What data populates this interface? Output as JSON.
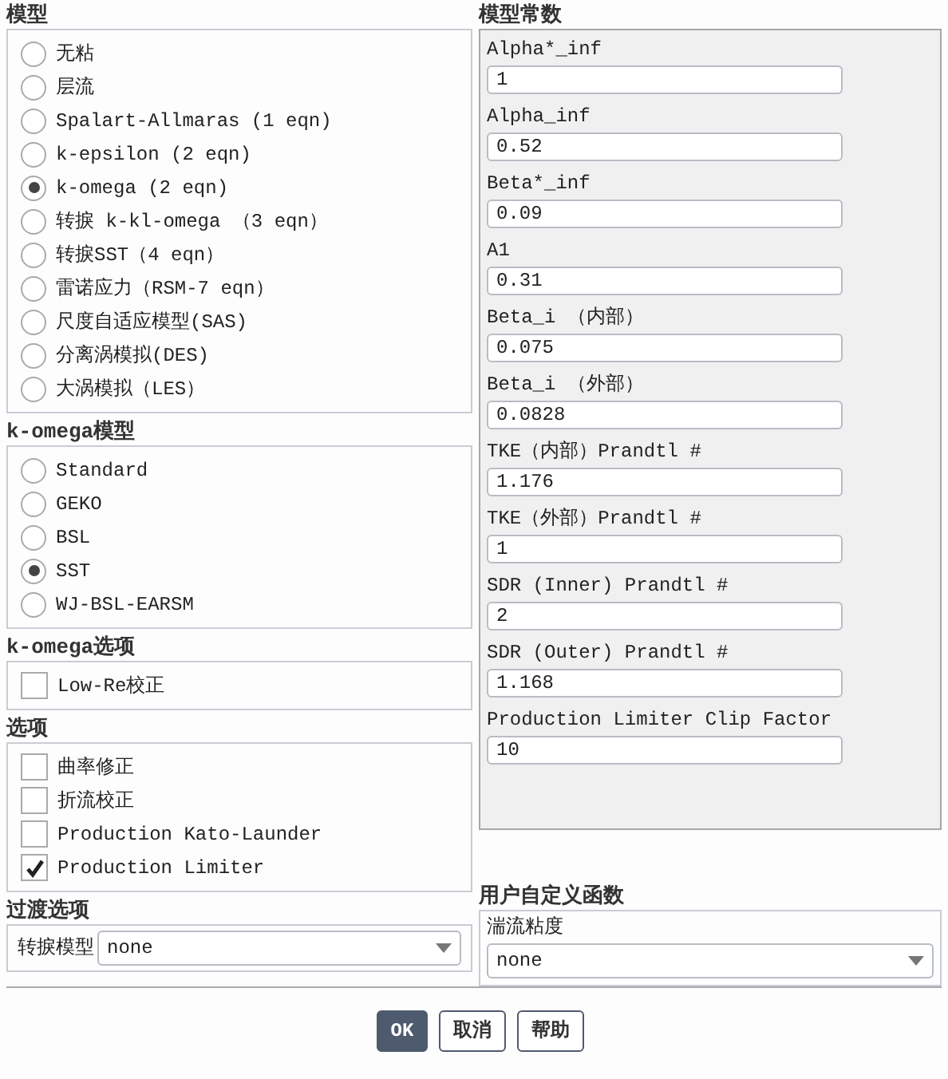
{
  "models": {
    "title": "模型",
    "options": [
      {
        "label": "无粘",
        "selected": false
      },
      {
        "label": "层流",
        "selected": false
      },
      {
        "label": "Spalart-Allmaras (1 eqn)",
        "selected": false
      },
      {
        "label": "k-epsilon (2 eqn)",
        "selected": false
      },
      {
        "label": "k-omega (2 eqn)",
        "selected": true
      },
      {
        "label": "转捩 k-kl-omega （3 eqn）",
        "selected": false
      },
      {
        "label": "转捩SST（4 eqn）",
        "selected": false
      },
      {
        "label": "雷诺应力（RSM-7 eqn）",
        "selected": false
      },
      {
        "label": "尺度自适应模型(SAS)",
        "selected": false
      },
      {
        "label": "分离涡模拟(DES)",
        "selected": false
      },
      {
        "label": "大涡模拟（LES）",
        "selected": false
      }
    ]
  },
  "komega_model": {
    "title": "k-omega模型",
    "options": [
      {
        "label": "Standard",
        "selected": false
      },
      {
        "label": "GEKO",
        "selected": false
      },
      {
        "label": "BSL",
        "selected": false
      },
      {
        "label": "SST",
        "selected": true
      },
      {
        "label": "WJ-BSL-EARSM",
        "selected": false
      }
    ]
  },
  "komega_options": {
    "title": "k-omega选项",
    "checkboxes": [
      {
        "label": "Low-Re校正",
        "checked": false
      }
    ]
  },
  "options": {
    "title": "选项",
    "checkboxes": [
      {
        "label": "曲率修正",
        "checked": false
      },
      {
        "label": "折流校正",
        "checked": false
      },
      {
        "label": "Production Kato-Launder",
        "checked": false
      },
      {
        "label": "Production Limiter",
        "checked": true
      }
    ]
  },
  "transition_options": {
    "title": "过渡选项",
    "field_label": "转捩模型",
    "dropdown": {
      "value": "none"
    }
  },
  "model_constants": {
    "title": "模型常数",
    "fields": [
      {
        "label": "Alpha*_inf",
        "value": "1"
      },
      {
        "label": "Alpha_inf",
        "value": "0.52"
      },
      {
        "label": "Beta*_inf",
        "value": "0.09"
      },
      {
        "label": "A1",
        "value": "0.31"
      },
      {
        "label": "Beta_i （内部）",
        "value": "0.075"
      },
      {
        "label": "Beta_i （外部）",
        "value": "0.0828"
      },
      {
        "label": "TKE（内部）Prandtl #",
        "value": "1.176"
      },
      {
        "label": "TKE（外部）Prandtl #",
        "value": "1"
      },
      {
        "label": "SDR (Inner) Prandtl #",
        "value": "2"
      },
      {
        "label": "SDR (Outer) Prandtl #",
        "value": "1.168"
      },
      {
        "label": "Production Limiter Clip Factor",
        "value": "10"
      }
    ]
  },
  "udf": {
    "title": "用户自定义函数",
    "field_label": "湍流粘度",
    "dropdown": {
      "value": "none"
    }
  },
  "buttons": [
    {
      "label": "OK",
      "kind": "primary"
    },
    {
      "label": "取消",
      "kind": "secondary"
    },
    {
      "label": "帮助",
      "kind": "secondary"
    }
  ]
}
